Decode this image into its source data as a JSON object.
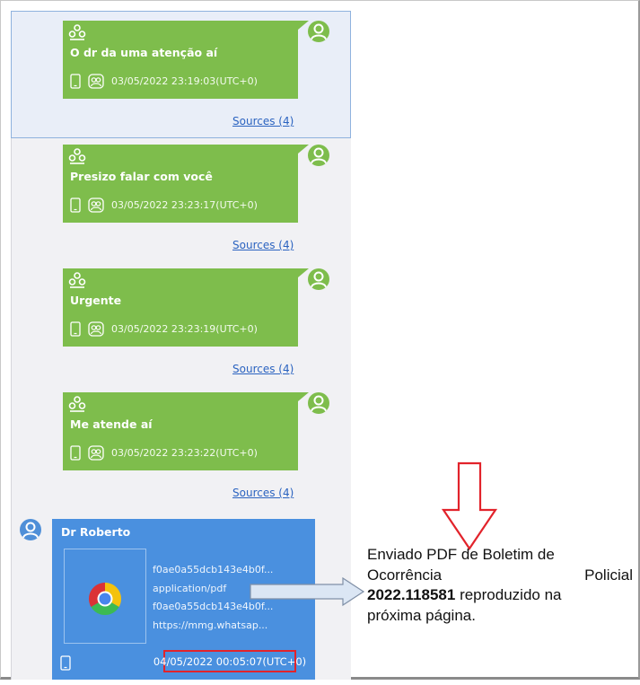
{
  "messages": [
    {
      "text": "O dr da uma atenção aí",
      "timestamp": "03/05/2022 23:19:03(UTC+0)",
      "sources": "Sources (4)"
    },
    {
      "text": "Presizo falar com você",
      "timestamp": "03/05/2022 23:23:17(UTC+0)",
      "sources": "Sources (4)"
    },
    {
      "text": "Urgente",
      "timestamp": "03/05/2022 23:23:19(UTC+0)",
      "sources": "Sources (4)"
    },
    {
      "text": "Me atende aí",
      "timestamp": "03/05/2022 23:23:22(UTC+0)",
      "sources": "Sources (4)"
    }
  ],
  "incoming": {
    "sender": "Dr Roberto",
    "file_lines": [
      "f0ae0a55dcb143e4b0f...",
      "application/pdf",
      "f0ae0a55dcb143e4b0f...",
      "https://mmg.whatsap..."
    ],
    "timestamp": "04/05/2022 00:05:07(UTC+0)"
  },
  "annotation": {
    "line1": "Enviado PDF de Boletim de",
    "line2_a": "Ocorrência",
    "line2_b": "Policial",
    "line3_bold": "2022.118581",
    "line3_rest": " reproduzido na",
    "line4": "próxima página."
  },
  "colors": {
    "outgoing_bubble": "#7ebd4c",
    "incoming_bubble": "#4a90df",
    "highlight_box": "#e2232b",
    "down_arrow": "#e2232b",
    "pointer_arrow": "#dbe6f4"
  },
  "icons": [
    "group-icon",
    "phone-icon",
    "read-status-icon",
    "user-avatar-icon",
    "chrome-icon",
    "down-arrow-icon",
    "right-arrow-icon"
  ]
}
